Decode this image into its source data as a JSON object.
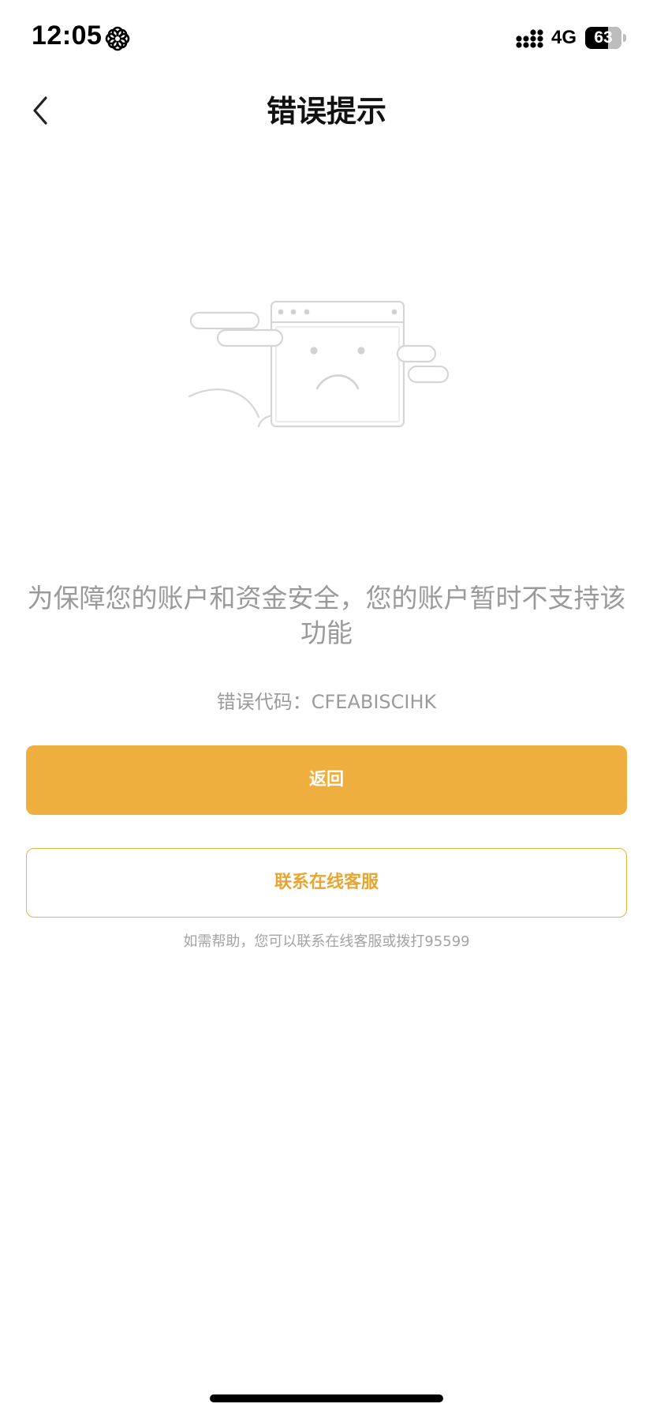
{
  "status_bar": {
    "time": "12:05",
    "focus_icon": "flower-focus-icon",
    "signal_icon": "cellular-signal-icon",
    "network": "4G",
    "battery_level": "63"
  },
  "nav": {
    "back_icon": "chevron-left-icon",
    "title": "错误提示"
  },
  "illustration": {
    "icon": "sad-browser-window-icon"
  },
  "error": {
    "message": "为保障您的账户和资金安全，您的账户暂时不支持该功能",
    "code_text": "错误代码：CFEABISCIHK"
  },
  "actions": {
    "back_label": "返回",
    "contact_label": "联系在线客服"
  },
  "help": {
    "text": "如需帮助，您可以联系在线客服或拨打95599"
  },
  "colors": {
    "accent": "#efaf3f",
    "secondary_text": "#9a9a9a"
  }
}
